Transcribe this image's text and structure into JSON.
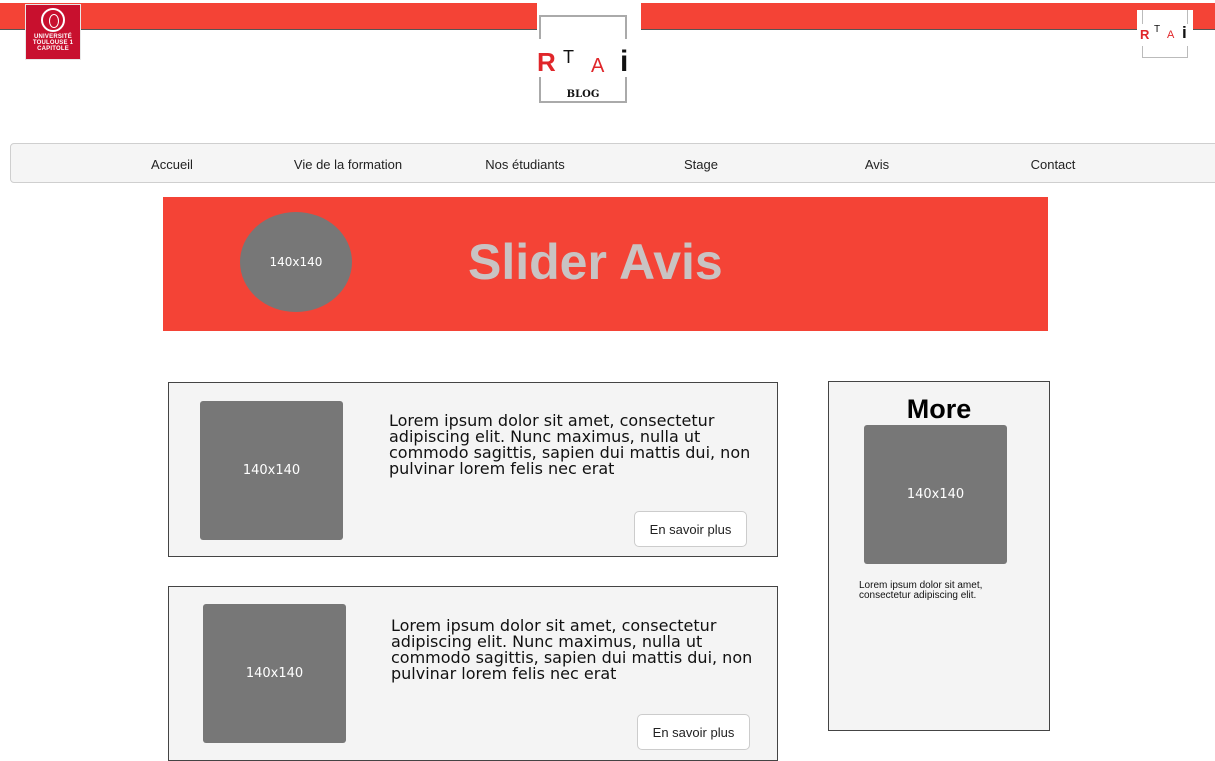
{
  "header": {
    "university_logo_lines": [
      "UNIVERSITÉ",
      "TOULOUSE 1",
      "CAPITOLE"
    ],
    "blog_logo": {
      "r": "R",
      "t": "T",
      "a": "A",
      "i": "i",
      "blog": "BLOG"
    },
    "small_logo": {
      "r": "R",
      "t": "T",
      "a": "A",
      "i": "i"
    },
    "accent_color": "#f44336"
  },
  "nav": {
    "items": [
      "Accueil",
      "Vie de la formation",
      "Nos étudiants",
      "Stage",
      "Avis",
      "Contact"
    ]
  },
  "slider": {
    "avatar_label": "140x140",
    "title": "Slider Avis"
  },
  "posts": [
    {
      "image_label": "140x140",
      "text": "Lorem ipsum dolor sit amet, consectetur adipiscing elit. Nunc maximus, nulla ut commodo sagittis, sapien dui mattis dui, non pulvinar lorem felis nec erat",
      "button": "En savoir plus"
    },
    {
      "image_label": "140x140",
      "text": "Lorem ipsum dolor sit amet, consectetur adipiscing elit. Nunc maximus, nulla ut commodo sagittis, sapien dui mattis dui, non pulvinar lorem felis nec erat",
      "button": "En savoir plus"
    }
  ],
  "sidebar": {
    "title": "More",
    "image_label": "140x140",
    "text": "Lorem ipsum dolor sit amet, consectetur adipiscing elit."
  }
}
